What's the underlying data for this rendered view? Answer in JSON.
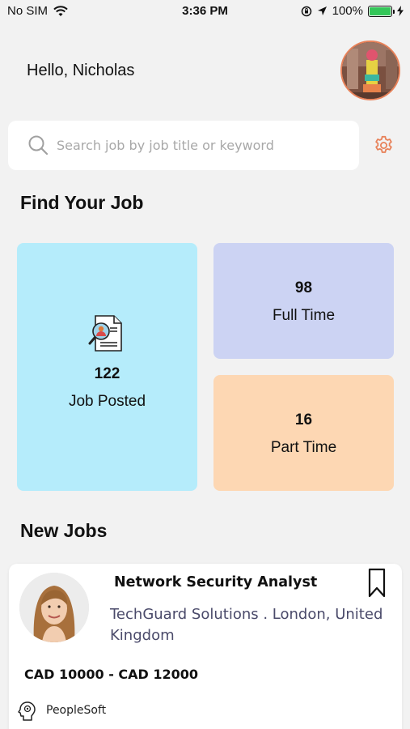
{
  "status_bar": {
    "carrier": "No SIM",
    "time": "3:36 PM",
    "battery": "100%",
    "battery_level": 1.0
  },
  "header": {
    "greeting": "Hello, Nicholas"
  },
  "search": {
    "placeholder": "Search job by job title or keyword"
  },
  "find_section": {
    "title": "Find Your Job"
  },
  "stats": {
    "posted": {
      "count": "122",
      "label": "Job Posted",
      "color": "#b5ecfb"
    },
    "full_time": {
      "count": "98",
      "label": "Full Time",
      "color": "#ccd3f3"
    },
    "part_time": {
      "count": "16",
      "label": "Part Time",
      "color": "#fdd7b3"
    }
  },
  "new_jobs": {
    "title": "New Jobs",
    "items": [
      {
        "title": "Network Security Analyst",
        "company": "TechGuard Solutions . London, United Kingdom",
        "salary": "CAD 10000 - CAD 12000",
        "tag": "PeopleSoft"
      }
    ]
  },
  "colors": {
    "accent": "#e8825a",
    "background": "#f2f2f2"
  }
}
